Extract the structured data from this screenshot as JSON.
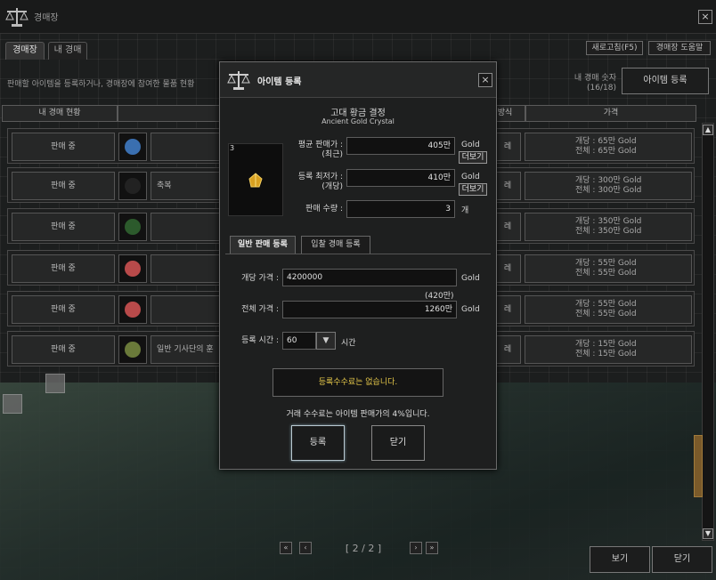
{
  "window": {
    "title": "경매장"
  },
  "tabs": [
    {
      "label": "경매장"
    },
    {
      "label": "내 경매"
    }
  ],
  "toolbar": {
    "refresh": "새로고침(F5)",
    "help": "경매장 도움말",
    "register": "아이템 등록"
  },
  "description": "판매할 아이템을 등록하거나, 경매장에 참여한 물품 현황",
  "my_auction": {
    "label": "내 경매 숫자",
    "count": "(16/18)"
  },
  "columns": {
    "status": "내 경매 현황",
    "method": "방식",
    "price": "가격"
  },
  "rows": [
    {
      "status": "판매 중",
      "name": "",
      "method": "레",
      "unit": "개당 : 65만 Gold",
      "total": "전체 : 65만 Gold",
      "thumb_color": "#3a6fb0"
    },
    {
      "status": "판매 중",
      "name": "축복",
      "method": "레",
      "unit": "개당 : 300만 Gold",
      "total": "전체 : 300만 Gold",
      "thumb_color": "#222222"
    },
    {
      "status": "판매 중",
      "name": "",
      "method": "레",
      "unit": "개당 : 350만 Gold",
      "total": "전체 : 350만 Gold",
      "thumb_color": "#2c5a2c"
    },
    {
      "status": "판매 중",
      "name": "",
      "method": "레",
      "unit": "개당 : 55만 Gold",
      "total": "전체 : 55만 Gold",
      "thumb_color": "#b84a4a"
    },
    {
      "status": "판매 중",
      "name": "",
      "method": "레",
      "unit": "개당 : 55만 Gold",
      "total": "전체 : 55만 Gold",
      "thumb_color": "#b84a4a"
    },
    {
      "status": "판매 중",
      "name": "일반 기사단의 훈",
      "method": "레",
      "unit": "개당 : 15만 Gold",
      "total": "전체 : 15만 Gold",
      "thumb_color": "#6a7a3a"
    }
  ],
  "pager": {
    "first": "«",
    "prev": "‹",
    "page": "[ 2 / 2 ]",
    "next": "›",
    "last": "»"
  },
  "footer": {
    "view": "보기",
    "close": "닫기"
  },
  "dialog": {
    "title": "아이템 등록",
    "item_name": "고대 황금 결정",
    "item_name_en": "Ancient Gold Crystal",
    "thumb_count": "3",
    "avg_price_label": "평균 판매가 :",
    "avg_price_sub": "(최근)",
    "avg_price": "405만",
    "min_price_label": "등록 최저가 :",
    "min_price_sub": "(개당)",
    "min_price": "410만",
    "gold": "Gold",
    "more": "더보기",
    "qty_label": "판매 수량 :",
    "qty": "3",
    "qty_unit": "개",
    "tab_normal": "일반 판매 등록",
    "tab_bid": "입찰 경매 등록",
    "unit_price_label": "개당 가격 :",
    "unit_price": "4200000",
    "unit_price_hint": "(420만)",
    "total_label": "전체 가격 :",
    "total": "1260만",
    "time_label": "등록 시간 :",
    "time": "60",
    "time_unit": "시간",
    "notice": "등록수수료는 없습니다.",
    "fee": "거래 수수료는 아이템 판매가의 4%입니다.",
    "register": "등록",
    "close": "닫기"
  }
}
